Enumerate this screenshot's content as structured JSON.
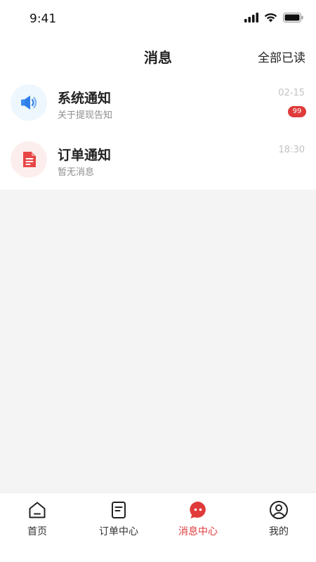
{
  "status_bar": {
    "time": "9:41"
  },
  "header": {
    "title": "消息",
    "mark_all_read": "全部已读"
  },
  "messages": [
    {
      "title": "系统通知",
      "subtitle": "关于提现告知",
      "time": "02-15",
      "badge": "99",
      "icon": "speaker-icon",
      "color": "#2f7ee8"
    },
    {
      "title": "订单通知",
      "subtitle": "暂无消息",
      "time": "18:30",
      "icon": "document-icon",
      "color": "#e84545"
    }
  ],
  "tabs": [
    {
      "label": "首页",
      "icon": "home-icon"
    },
    {
      "label": "订单中心",
      "icon": "order-list-icon"
    },
    {
      "label": "消息中心",
      "icon": "chat-bubble-icon",
      "active": true
    },
    {
      "label": "我的",
      "icon": "user-icon"
    }
  ],
  "colors": {
    "accent": "#e03a3a",
    "background": "#f4f4f4"
  }
}
